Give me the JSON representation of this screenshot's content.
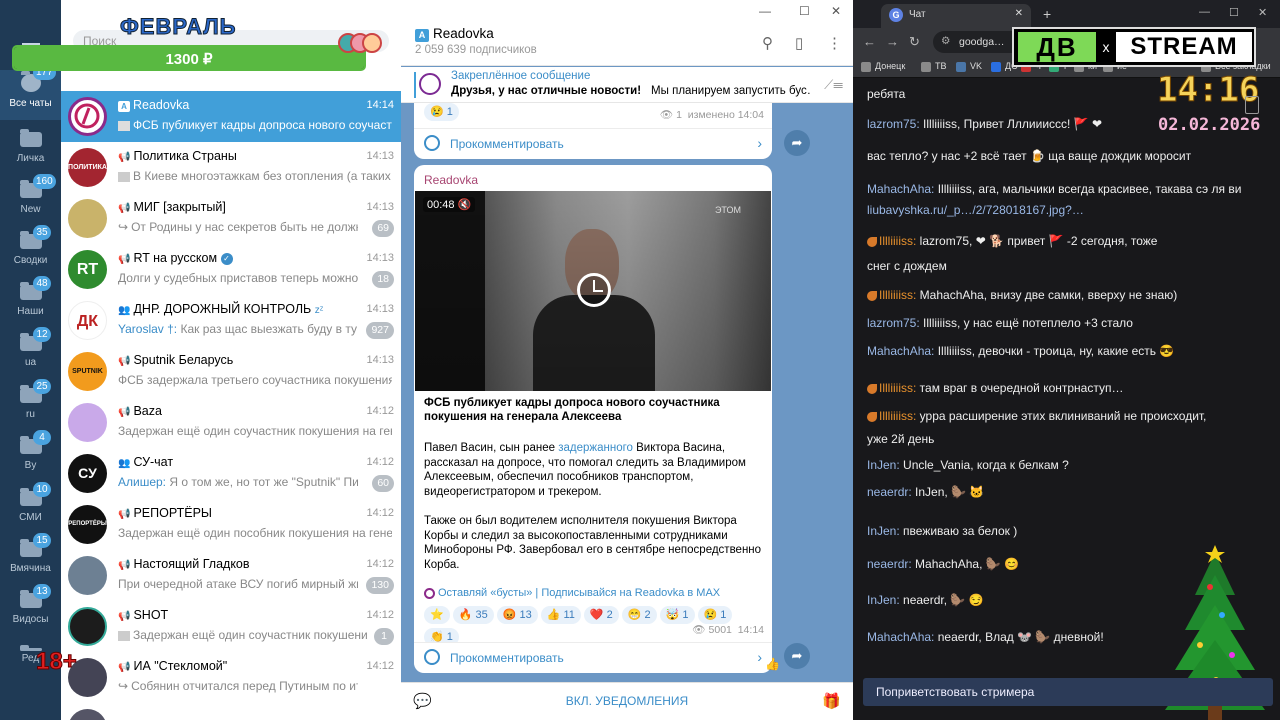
{
  "folders": [
    {
      "label": "Все чаты",
      "count": "177"
    },
    {
      "label": "Личка",
      "count": ""
    },
    {
      "label": "New",
      "count": "160"
    },
    {
      "label": "Сводки",
      "count": "35"
    },
    {
      "label": "Наши",
      "count": "48"
    },
    {
      "label": "ua",
      "count": "12"
    },
    {
      "label": "ru",
      "count": "25"
    },
    {
      "label": "By",
      "count": "4"
    },
    {
      "label": "СМИ",
      "count": "10"
    },
    {
      "label": "Вмячина",
      "count": "15"
    },
    {
      "label": "Видосы",
      "count": "13"
    },
    {
      "label": "Ред",
      "count": ""
    }
  ],
  "search": {
    "placeholder": "Поиск"
  },
  "overlay": {
    "month": "ФЕВРАЛЬ",
    "price": "1300 ₽",
    "progress": 1.0,
    "age": "18+"
  },
  "chats": [
    {
      "name": "Readovka",
      "time": "14:14",
      "preview": "ФСБ публикует кадры допроса нового соучастни…",
      "badge": "",
      "color": "#ffffff"
    },
    {
      "name": "Политика Страны",
      "time": "14:13",
      "preview": "В Киеве многоэтажкам без отопления (а таких с…",
      "badge": "",
      "color": "#a32530",
      "avtext": "ПОЛИТИКА"
    },
    {
      "name": "МИГ [закрытый]",
      "time": "14:13",
      "preview": "От Родины у нас секретов быть не должно.",
      "badge": "69",
      "color": "#c9b36a"
    },
    {
      "name": "RT на русском",
      "time": "14:13",
      "preview": "Долги у судебных приставов теперь можно пр…",
      "badge": "18",
      "color": "#2e8b2e",
      "avtext": "RT"
    },
    {
      "name": "ДНР. ДОРОЖНЫЙ КОНТРОЛЬ",
      "time": "14:13",
      "preview": "Как раз щас выезжать буду в ту ст…",
      "sender": "Yaroslav †:",
      "badge": "927",
      "color": "#ffffff",
      "avtext": "ДК"
    },
    {
      "name": "Sputnik Беларусь",
      "time": "14:13",
      "preview": "ФСБ задержала третьего соучастника покушения н…",
      "badge": "",
      "color": "#f29b1d",
      "avtext": "SPUTNIK"
    },
    {
      "name": "Baza",
      "time": "14:12",
      "preview": "Задержан ещё один соучастник покушения на гене…",
      "badge": "",
      "color": "#c9a9e9"
    },
    {
      "name": "СУ-чат",
      "time": "14:12",
      "preview": "Я о том же, но тот же \"Sputnik\" Пишет,…",
      "sender": "Алишер:",
      "badge": "60",
      "color": "#111111",
      "avtext": "СУ"
    },
    {
      "name": "РЕПОРТЁРЫ",
      "time": "14:12",
      "preview": "Задержан ещё один пособник покушения на гене…",
      "badge": "",
      "color": "#111111",
      "avtext": "РЕПОРТЁРЫ"
    },
    {
      "name": "Настоящий Гладков",
      "time": "14:12",
      "preview": "При очередной атаке ВСУ погиб мирный жит…",
      "badge": "130",
      "color": "#6d8093"
    },
    {
      "name": "SHOT",
      "time": "14:12",
      "preview": "Задержан ещё один соучастник покушения …",
      "badge": "1",
      "color": "#1c1c1c"
    },
    {
      "name": "ИА \"Стекломой\"",
      "time": "14:12",
      "preview": "Собянин отчитался перед Путиным по ито…",
      "badge": "",
      "color": "#445"
    }
  ],
  "pane": {
    "window_controls": [
      "—",
      "☐",
      "✕"
    ],
    "title": "Readovka",
    "subscribers": "2 059 639 подписчиков",
    "pinned_title": "Закреплённое сообщение",
    "pinned_bold": "Друзья, у нас отличные новости!",
    "pinned_text": "Мы планируем запустить бус…",
    "msg1_react": "😢 1",
    "msg1_views": "1",
    "msg1_edited": "изменено 14:04",
    "comment_label": "Прокомментировать",
    "msg2_source": "Readovka",
    "video_time": "00:48",
    "video_watermark": "ЭТОМ",
    "msg2_heading": "ФСБ публикует кадры допроса нового соучастника покушения на генерала Алексеева",
    "msg2_p1a": "Павел Васин, сын ранее ",
    "msg2_p1link": "задержанного",
    "msg2_p1b": " Виктора Васина, рассказал на допросе, что помогал следить за Владимиром Алексеевым, обеспечил пособников транспортом, видеорегистратором и трекером.",
    "msg2_p2": "Также он был водителем исполнителя покушения Виктора Корбы и следил за высокопоставленными сотрудниками Минобороны РФ. Завербовал его в сентябре непосредственно Корба.",
    "msg2_promo": "Оставляй «бусты» | Подписывайся на Readovka в MAX",
    "reactions": [
      "⭐",
      "🔥 35",
      "😡 13",
      "👍 11",
      "❤️ 2",
      "😁 2",
      "🤯 1",
      "😢 1",
      "👏 1"
    ],
    "msg2_views": "5001",
    "msg2_time": "14:14",
    "unmute": "ВКЛ. УВЕДОМЛЕНИЯ"
  },
  "browser": {
    "tab_title": "Чат",
    "url": "goodga…",
    "bookmarks": [
      "Донецк",
      "ТВ",
      "VK",
      "ДС",
      "Ч",
      "т",
      "ки",
      "ие",
      "Все закладки"
    ],
    "logo_left": "ДВ",
    "logo_x": "x",
    "logo_right": "STREAM",
    "clock": "14:16",
    "date": "02.02.2026",
    "greet": "Поприветствовать стримера"
  },
  "stream_chat": [
    {
      "user": "",
      "text": "ребята"
    },
    {
      "user": "lazrom75:",
      "text": " Illliiiiss, Привет Лллиииссс! 🚩 ❤"
    },
    {
      "user": "",
      "text": "вас тепло? у нас +2 всё тает 🍺 ща ваще дождик моросит"
    },
    {
      "user": "MahachAha:",
      "text": " Illliiiiss, ага, мальчики всегда красивее, такава сэ ля ви"
    },
    {
      "user": "",
      "text": "liubavyshka.ru/_p…/2/728018167.jpg?…",
      "link": true
    },
    {
      "user": "Illliiiiss:",
      "wolf": true,
      "text": " lazrom75, ❤ 🐕 привет 🚩 -2 сегодня, тоже"
    },
    {
      "user": "",
      "text": "снег с дождем"
    },
    {
      "user": "Illliiiiss:",
      "wolf": true,
      "text": " MahachAha, внизу две самки, вверху не знаю)"
    },
    {
      "user": "lazrom75:",
      "text": " Illliiiiss, у нас ещё потеплело +3 стало"
    },
    {
      "user": "MahachAha:",
      "text": " Illliiiiss, девочки - троица, ну, какие есть 😎"
    },
    {
      "user": "Illliiiiss:",
      "wolf": true,
      "text": " там враг в очередной контрнаступ…"
    },
    {
      "user": "Illliiiiss:",
      "wolf": true,
      "text": " урра расширение этих вклиниваний не происходит,"
    },
    {
      "user": "",
      "text": "уже 2й день"
    },
    {
      "user": "InJen:",
      "text": " Uncle_Vania, когда к белкам ?"
    },
    {
      "user": "neaerdr:",
      "text": " InJen, 🦫 🐱"
    },
    {
      "user": "InJen:",
      "text": " пвеживаю за белок )"
    },
    {
      "user": "neaerdr:",
      "text": " MahachAha, 🦫 😊"
    },
    {
      "user": "InJen:",
      "text": " neaerdr, 🦫 😏"
    },
    {
      "user": "MahachAha:",
      "text": " neaerdr, Влад 🐭 🦫 дневной!"
    }
  ]
}
